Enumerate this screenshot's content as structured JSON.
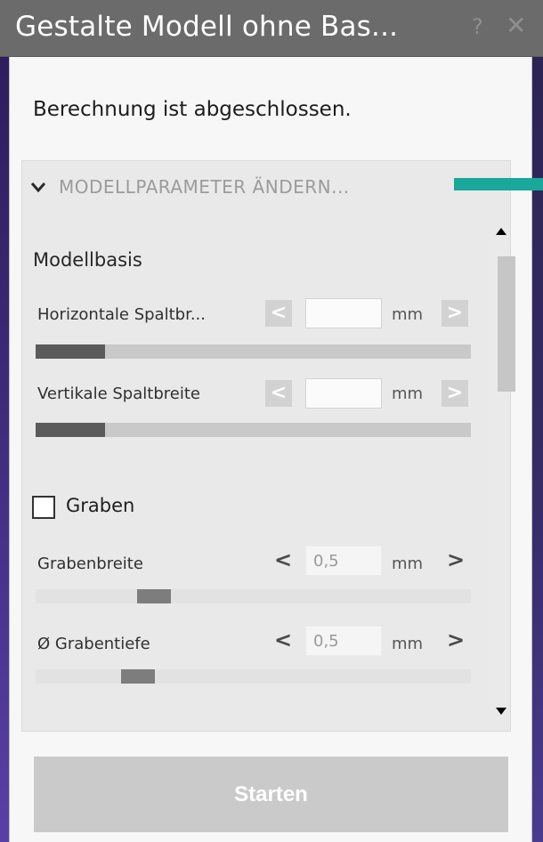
{
  "window": {
    "title": "Gestalte Modell ohne Bas...",
    "help_glyph": "?",
    "close_glyph": "✕"
  },
  "status_text": "Berechnung ist abgeschlossen.",
  "section": {
    "title": "MODELLPARAMETER ÄNDERN...",
    "expanded": true
  },
  "model_base": {
    "heading": "Modellbasis",
    "horizontal": {
      "label": "Horizontale Spaltbr...",
      "value": "",
      "unit": "mm",
      "slider_fraction": 0.16
    },
    "vertical": {
      "label": "Vertikale Spaltbreite",
      "value": "",
      "unit": "mm",
      "slider_fraction": 0.16
    }
  },
  "trench": {
    "checkbox_label": "Graben",
    "checked": false,
    "width": {
      "label": "Grabenbreite",
      "value": "0,5",
      "unit": "mm"
    },
    "depth": {
      "label": "Ø Grabentiefe",
      "value": "0,5",
      "unit": "mm"
    }
  },
  "arrows": {
    "left": "<",
    "right": ">"
  },
  "start_button": "Starten",
  "icons": [
    "chevron-down-icon",
    "help-icon",
    "close-icon",
    "scroll-up-icon",
    "scroll-down-icon"
  ],
  "colors": {
    "title_bar": "#6b6b6b",
    "accent_marker": "#1aa89a",
    "button_disabled": "#cacaca"
  }
}
